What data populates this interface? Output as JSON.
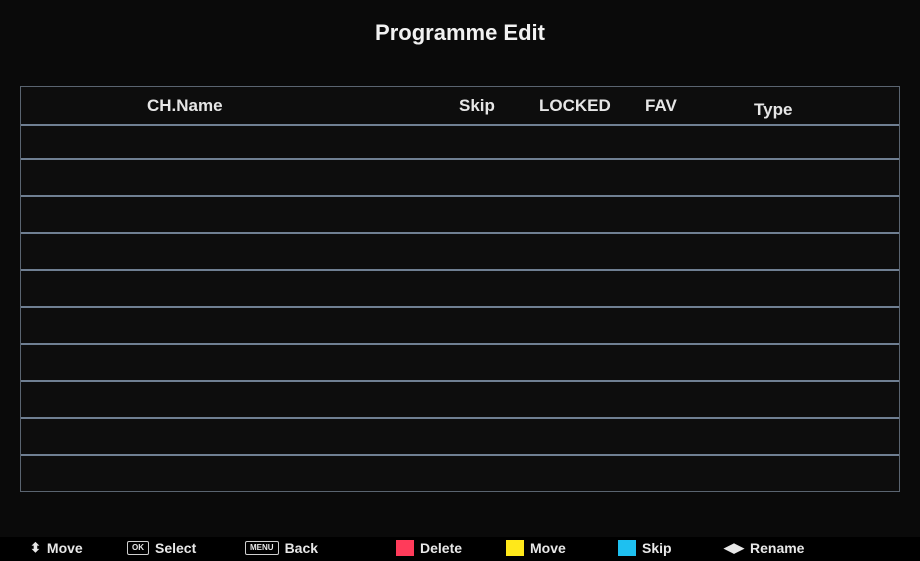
{
  "title": "Programme Edit",
  "columns": {
    "ch_name": "CH.Name",
    "skip": "Skip",
    "locked": "LOCKED",
    "fav": "FAV",
    "type": "Type"
  },
  "rows": [
    {
      "ch_name": "",
      "skip": "",
      "locked": "",
      "fav": "",
      "type": ""
    },
    {
      "ch_name": "",
      "skip": "",
      "locked": "",
      "fav": "",
      "type": ""
    },
    {
      "ch_name": "",
      "skip": "",
      "locked": "",
      "fav": "",
      "type": ""
    },
    {
      "ch_name": "",
      "skip": "",
      "locked": "",
      "fav": "",
      "type": ""
    },
    {
      "ch_name": "",
      "skip": "",
      "locked": "",
      "fav": "",
      "type": ""
    },
    {
      "ch_name": "",
      "skip": "",
      "locked": "",
      "fav": "",
      "type": ""
    },
    {
      "ch_name": "",
      "skip": "",
      "locked": "",
      "fav": "",
      "type": ""
    },
    {
      "ch_name": "",
      "skip": "",
      "locked": "",
      "fav": "",
      "type": ""
    },
    {
      "ch_name": "",
      "skip": "",
      "locked": "",
      "fav": "",
      "type": ""
    },
    {
      "ch_name": "",
      "skip": "",
      "locked": "",
      "fav": "",
      "type": ""
    }
  ],
  "hints": {
    "move_label": "Move",
    "select_key": "OK",
    "select_label": "Select",
    "back_key": "MENU",
    "back_label": "Back",
    "delete_label": "Delete",
    "move_color_label": "Move",
    "skip_label": "Skip",
    "rename_label": "Rename"
  },
  "colors": {
    "delete": "#ff3b5a",
    "move": "#ffe81a",
    "skip": "#1ec0f0",
    "grid": "#6f7f92"
  },
  "icons": {
    "move": "up-down-arrows-icon",
    "rename": "left-right-arrows-icon"
  }
}
